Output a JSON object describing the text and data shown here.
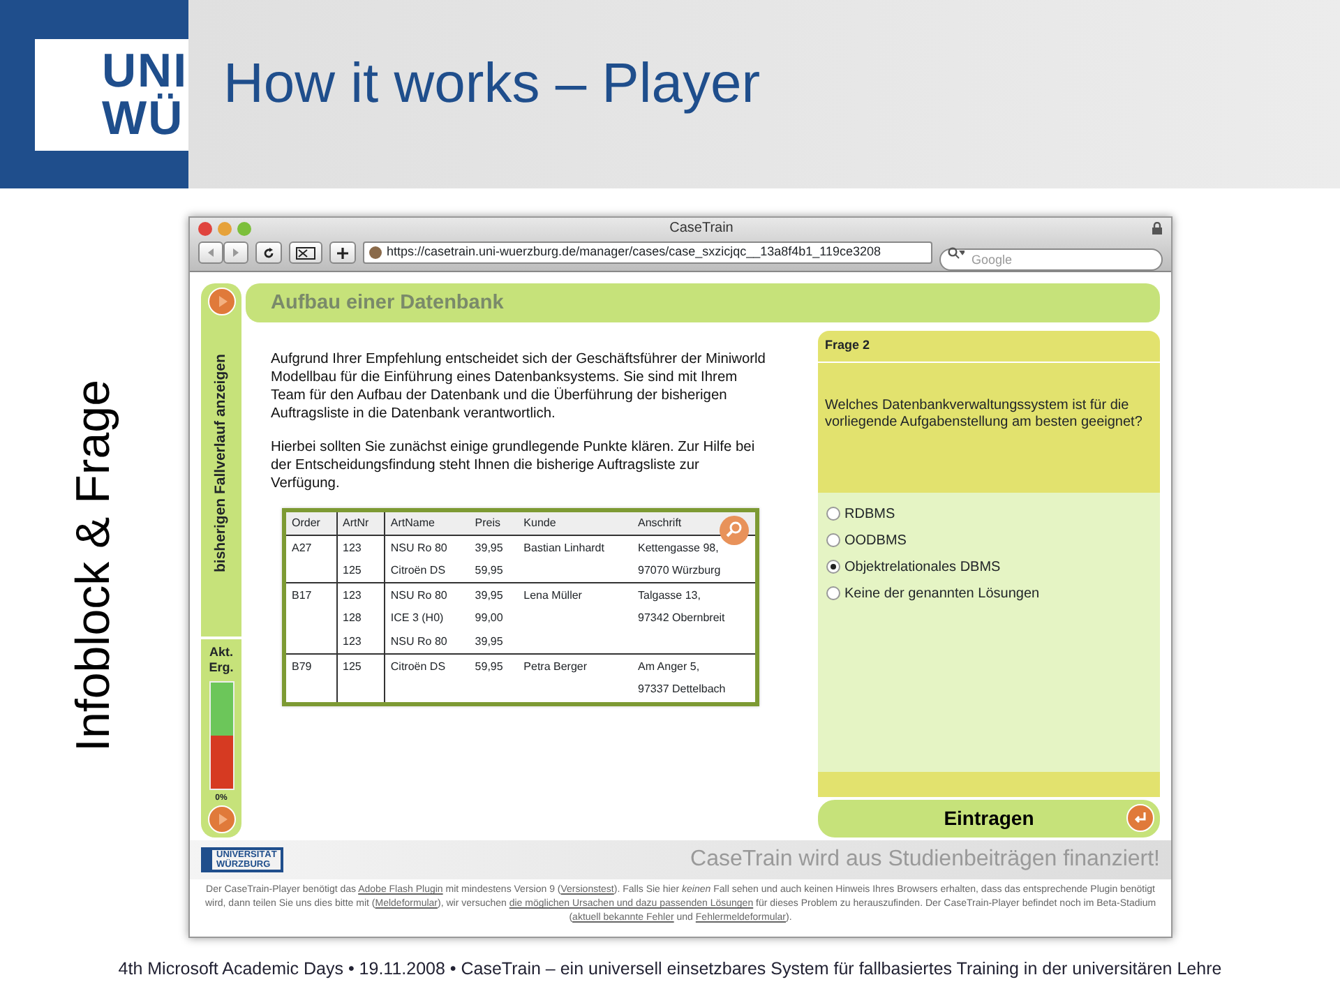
{
  "slide": {
    "logo_lines": [
      "UNI",
      "WÜ"
    ],
    "title": "How it works – Player",
    "side_label": "Infoblock & Frage",
    "footer": "4th Microsoft Academic Days  • 19.11.2008 • CaseTrain – ein universell einsetzbares System für fallbasiertes Training in der universitären Lehre"
  },
  "browser": {
    "title": "CaseTrain",
    "url": "https://casetrain.uni-wuerzburg.de/manager/cases/case_sxzicjqc__13a8f4b1_119ce3208",
    "search": {
      "placeholder": "Google"
    }
  },
  "sidebar": {
    "history_label": "bisherigen Fallverlauf anzeigen",
    "result_label": "Akt. Erg.",
    "result_reading": "0%"
  },
  "case": {
    "title": "Aufbau einer Datenbank",
    "paragraphs": [
      "Aufgrund Ihrer Empfehlung entscheidet sich der Geschäftsführer der Miniworld Modellbau für die Einführung eines Datenbanksystems. Sie sind mit Ihrem Team für den Aufbau der Datenbank und die Überführung der bisherigen Auftragsliste in die Datenbank verantwortlich.",
      "Hierbei sollten Sie zunächst einige grundlegende Punkte klären. Zur Hilfe bei der Entscheidungsfindung steht Ihnen die bisherige Auftragsliste zur Verfügung."
    ],
    "table": {
      "columns": [
        "Order",
        "ArtNr",
        "ArtName",
        "Preis",
        "Kunde",
        "Anschrift"
      ],
      "rows": [
        {
          "order": "A27",
          "customer": "Bastian Linhardt",
          "address": [
            "Kettengasse 98,",
            "97070 Würzburg"
          ],
          "items": [
            {
              "artnr": "123",
              "artname": "NSU Ro 80",
              "price": "39,95"
            },
            {
              "artnr": "125",
              "artname": "Citroën DS",
              "price": "59,95"
            }
          ]
        },
        {
          "order": "B17",
          "customer": "Lena Müller",
          "address": [
            "Talgasse 13,",
            "97342 Obernbreit"
          ],
          "items": [
            {
              "artnr": "123",
              "artname": "NSU Ro 80",
              "price": "39,95"
            },
            {
              "artnr": "128",
              "artname": "ICE 3 (H0)",
              "price": "99,00"
            },
            {
              "artnr": "123",
              "artname": "NSU Ro 80",
              "price": "39,95"
            }
          ]
        },
        {
          "order": "B79",
          "customer": "Petra Berger",
          "address": [
            "Am Anger 5,",
            "97337 Dettelbach"
          ],
          "items": [
            {
              "artnr": "125",
              "artname": "Citroën DS",
              "price": "59,95"
            }
          ]
        }
      ]
    }
  },
  "question": {
    "heading": "Frage 2",
    "text": "Welches Datenbankverwaltungssystem ist für die vorliegende Aufgabenstellung am besten geeignet?",
    "options": [
      {
        "label": "RDBMS",
        "selected": false
      },
      {
        "label": "OODBMS",
        "selected": false
      },
      {
        "label": "Objektrelationales DBMS",
        "selected": true
      },
      {
        "label": "Keine der genannten Lösungen",
        "selected": false
      }
    ],
    "submit": "Eintragen"
  },
  "page_footer": {
    "logo_lines": [
      "UNIVERSITÄT",
      "WÜRZBURG"
    ],
    "slogan": "CaseTrain wird aus Studienbeiträgen finanziert!",
    "notice": [
      {
        "kind": "text",
        "text": "Der CaseTrain-Player benötigt das "
      },
      {
        "kind": "link",
        "text": "Adobe Flash Plugin"
      },
      {
        "kind": "text",
        "text": " mit mindestens Version 9 ("
      },
      {
        "kind": "link",
        "text": "Versionstest"
      },
      {
        "kind": "text",
        "text": "). Falls Sie hier *keinen* Fall sehen und auch keinen Hinweis Ihres Browsers erhalten, dass das entsprechende Plugin benötigt wird, dann teilen Sie uns dies bitte mit ("
      },
      {
        "kind": "link",
        "text": "Meldeformular"
      },
      {
        "kind": "text",
        "text": "), wir versuchen "
      },
      {
        "kind": "link",
        "text": "die möglichen Ursachen und dazu passenden Lösungen"
      },
      {
        "kind": "text",
        "text": " für dieses Problem zu herauszufinden. Der CaseTrain-Player befindet noch im Beta-Stadium ("
      },
      {
        "kind": "link",
        "text": "aktuell bekannte Fehler"
      },
      {
        "kind": "text",
        "text": " und "
      },
      {
        "kind": "link",
        "text": "Fehlermeldeformular"
      },
      {
        "kind": "text",
        "text": ")."
      }
    ]
  }
}
